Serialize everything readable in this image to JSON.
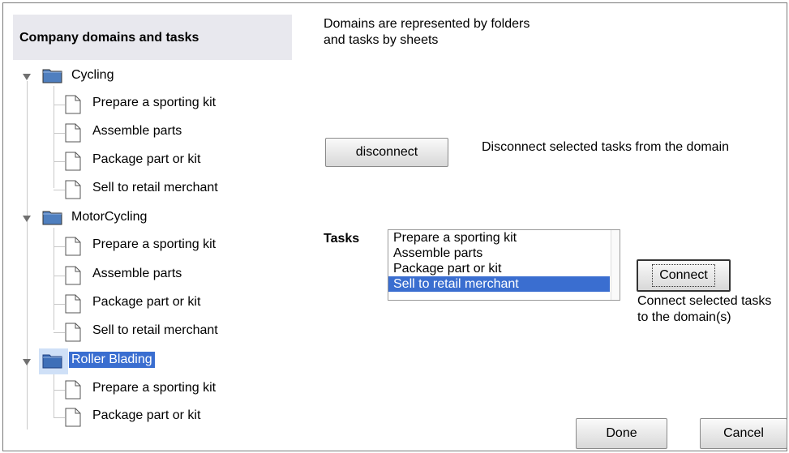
{
  "tree": {
    "header": "Company domains and tasks",
    "domains": [
      {
        "label": "Cycling",
        "tasks": [
          "Prepare a sporting kit",
          "Assemble parts",
          "Package part or kit",
          "Sell to retail merchant"
        ]
      },
      {
        "label": "MotorCycling",
        "tasks": [
          "Prepare a sporting kit",
          "Assemble parts",
          "Package part or kit",
          "Sell to retail merchant"
        ]
      },
      {
        "label": "Roller Blading",
        "selected": true,
        "tasks": [
          "Prepare a sporting kit",
          "Package part or kit"
        ]
      }
    ]
  },
  "info": {
    "line1": "Domains are represented by folders",
    "line2": "and tasks by sheets"
  },
  "disconnect": {
    "button_label": "disconnect",
    "description": "Disconnect selected tasks from the domain"
  },
  "tasks": {
    "label": "Tasks",
    "items": [
      "Prepare a sporting kit",
      "Assemble parts",
      "Package part or kit",
      "Sell to retail merchant"
    ],
    "selected_item": "Sell to retail merchant"
  },
  "connect": {
    "button_label": "Connect",
    "description_line1": "Connect selected tasks",
    "description_line2": "to the domain(s)"
  },
  "footer": {
    "done_label": "Done",
    "cancel_label": "Cancel"
  },
  "colors": {
    "selection": "#3a6ed0",
    "header_bg": "#e8e8ee",
    "folder_fill": "#4f7fbf"
  }
}
